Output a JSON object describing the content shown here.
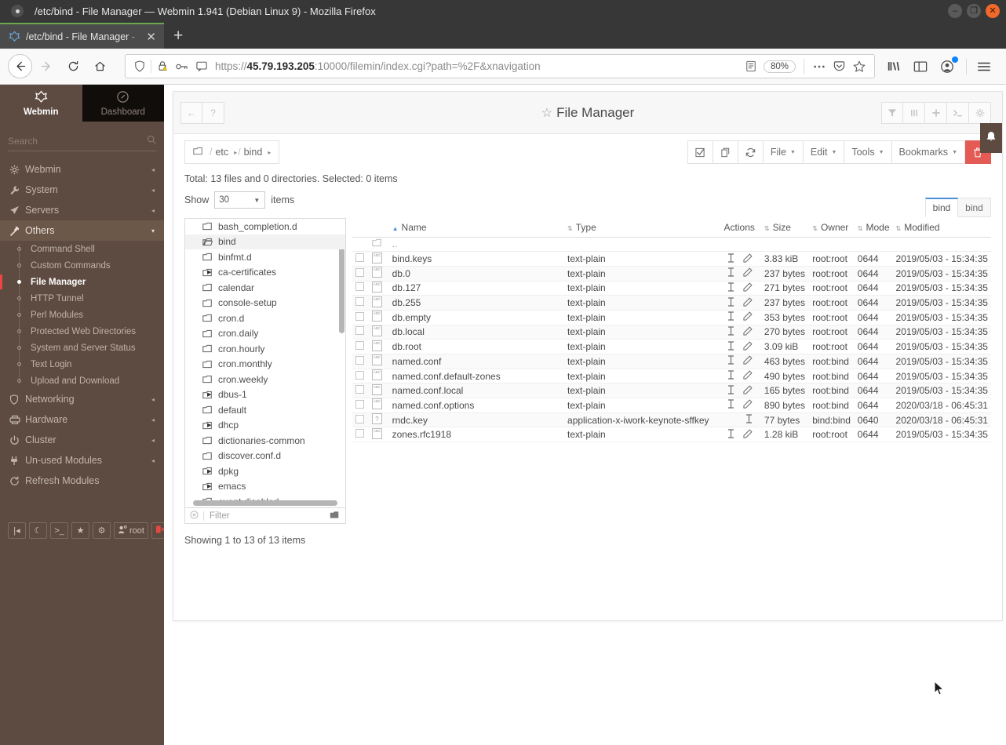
{
  "browser": {
    "window_title": "/etc/bind - File Manager — Webmin 1.941 (Debian Linux 9) - Mozilla Firefox",
    "tab_title": "/etc/bind - File Manager -",
    "tab_close_label": "✕",
    "new_tab_label": "+",
    "minimize_label": "–",
    "maximize_label": "❐",
    "close_label": "✕",
    "url_prefix": "https://",
    "url_host": "45.79.193.205",
    "url_rest": ":10000/filemin/index.cgi?path=%2F&xnavigation",
    "zoom_level": "80%"
  },
  "sidebar": {
    "tabs": [
      {
        "label": "Webmin",
        "icon": "webmin-logo-icon",
        "active": true
      },
      {
        "label": "Dashboard",
        "icon": "gauge-icon",
        "active": false
      }
    ],
    "search_placeholder": "Search",
    "items": [
      {
        "label": "Webmin",
        "icon": "gear-icon",
        "caret": "◂"
      },
      {
        "label": "System",
        "icon": "wrench-icon",
        "caret": "◂"
      },
      {
        "label": "Servers",
        "icon": "paper-plane-icon",
        "caret": "◂"
      },
      {
        "label": "Others",
        "icon": "hammer-icon",
        "caret": "▾",
        "open": true
      }
    ],
    "others_children": [
      {
        "label": "Command Shell"
      },
      {
        "label": "Custom Commands"
      },
      {
        "label": "File Manager",
        "active": true
      },
      {
        "label": "HTTP Tunnel"
      },
      {
        "label": "Perl Modules"
      },
      {
        "label": "Protected Web Directories"
      },
      {
        "label": "System and Server Status"
      },
      {
        "label": "Text Login"
      },
      {
        "label": "Upload and Download"
      }
    ],
    "items_after": [
      {
        "label": "Networking",
        "icon": "shield-icon",
        "caret": "◂"
      },
      {
        "label": "Hardware",
        "icon": "printer-icon",
        "caret": "◂"
      },
      {
        "label": "Cluster",
        "icon": "power-icon",
        "caret": "◂"
      },
      {
        "label": "Un-used Modules",
        "icon": "plug-icon",
        "caret": "◂"
      },
      {
        "label": "Refresh Modules",
        "icon": "refresh-icon",
        "caret": ""
      }
    ],
    "footer_buttons": [
      {
        "name": "collapse-sidebar-button",
        "label": "|◂"
      },
      {
        "name": "night-mode-button",
        "label": "☾"
      },
      {
        "name": "terminal-button",
        "label": ">_"
      },
      {
        "name": "favorites-button",
        "label": "★"
      },
      {
        "name": "theme-settings-button",
        "label": "⚙"
      },
      {
        "name": "user-button",
        "label": "root"
      },
      {
        "name": "logout-button",
        "label": "⇥"
      }
    ]
  },
  "filemanager": {
    "title": "File Manager",
    "star_icon": "☆",
    "header_left_buttons": [
      {
        "name": "back-button",
        "label": "←"
      },
      {
        "name": "help-button",
        "label": "?"
      }
    ],
    "header_right_buttons": [
      {
        "name": "filter-button",
        "label": "⧩"
      },
      {
        "name": "columns-button",
        "label": "|||"
      },
      {
        "name": "add-button",
        "label": "✛"
      },
      {
        "name": "console-button",
        "label": ">_"
      },
      {
        "name": "settings-button",
        "label": "⚙"
      }
    ],
    "notification_icon": "bell-icon",
    "breadcrumb": {
      "root_icon": "folder-icon",
      "segments": [
        "etc",
        "bind"
      ]
    },
    "toolbar": [
      {
        "name": "select-all-button",
        "label": "☑",
        "type": "icon"
      },
      {
        "name": "extract-button",
        "label": "⎋",
        "type": "icon"
      },
      {
        "name": "refresh-button",
        "label": "⟳",
        "type": "icon"
      },
      {
        "name": "file-menu",
        "label": "File",
        "type": "menu"
      },
      {
        "name": "edit-menu",
        "label": "Edit",
        "type": "menu"
      },
      {
        "name": "tools-menu",
        "label": "Tools",
        "type": "menu"
      },
      {
        "name": "bookmarks-menu",
        "label": "Bookmarks",
        "type": "menu"
      },
      {
        "name": "delete-button",
        "label": "🗑",
        "type": "danger"
      }
    ],
    "totals_text": "Total: 13 files and 0 directories. Selected: 0 items",
    "show_label": "Show",
    "show_value": "30",
    "items_label": "items",
    "view_tabs": [
      {
        "label": "bind",
        "active": true
      },
      {
        "label": "bind",
        "active": false
      }
    ],
    "filter_placeholder": "Filter",
    "footer_text": "Showing 1 to 13 of 13 items",
    "tree": [
      {
        "label": "bash_completion.d",
        "expandable": false,
        "selected": false
      },
      {
        "label": "bind",
        "expandable": false,
        "selected": true
      },
      {
        "label": "binfmt.d",
        "expandable": false,
        "selected": false
      },
      {
        "label": "ca-certificates",
        "expandable": true,
        "selected": false
      },
      {
        "label": "calendar",
        "expandable": false,
        "selected": false
      },
      {
        "label": "console-setup",
        "expandable": false,
        "selected": false
      },
      {
        "label": "cron.d",
        "expandable": false,
        "selected": false
      },
      {
        "label": "cron.daily",
        "expandable": false,
        "selected": false
      },
      {
        "label": "cron.hourly",
        "expandable": false,
        "selected": false
      },
      {
        "label": "cron.monthly",
        "expandable": false,
        "selected": false
      },
      {
        "label": "cron.weekly",
        "expandable": false,
        "selected": false
      },
      {
        "label": "dbus-1",
        "expandable": true,
        "selected": false
      },
      {
        "label": "default",
        "expandable": false,
        "selected": false
      },
      {
        "label": "dhcp",
        "expandable": true,
        "selected": false
      },
      {
        "label": "dictionaries-common",
        "expandable": false,
        "selected": false
      },
      {
        "label": "discover.conf.d",
        "expandable": false,
        "selected": false
      },
      {
        "label": "dpkg",
        "expandable": true,
        "selected": false
      },
      {
        "label": "emacs",
        "expandable": true,
        "selected": false
      },
      {
        "label": "event.disabled",
        "expandable": false,
        "selected": false
      }
    ],
    "columns": [
      "Name",
      "Type",
      "Actions",
      "Size",
      "Owner",
      "Mode",
      "Modified"
    ],
    "parent_row_label": "..",
    "rows": [
      {
        "name": "bind.keys",
        "type": "text-plain",
        "size": "3.83 kiB",
        "owner": "root:root",
        "mode": "0644",
        "modified": "2019/05/03 - 15:34:35",
        "icon": "text-file-icon",
        "editable": true
      },
      {
        "name": "db.0",
        "type": "text-plain",
        "size": "237 bytes",
        "owner": "root:root",
        "mode": "0644",
        "modified": "2019/05/03 - 15:34:35",
        "icon": "text-file-icon",
        "editable": true
      },
      {
        "name": "db.127",
        "type": "text-plain",
        "size": "271 bytes",
        "owner": "root:root",
        "mode": "0644",
        "modified": "2019/05/03 - 15:34:35",
        "icon": "text-file-icon",
        "editable": true
      },
      {
        "name": "db.255",
        "type": "text-plain",
        "size": "237 bytes",
        "owner": "root:root",
        "mode": "0644",
        "modified": "2019/05/03 - 15:34:35",
        "icon": "text-file-icon",
        "editable": true
      },
      {
        "name": "db.empty",
        "type": "text-plain",
        "size": "353 bytes",
        "owner": "root:root",
        "mode": "0644",
        "modified": "2019/05/03 - 15:34:35",
        "icon": "text-file-icon",
        "editable": true
      },
      {
        "name": "db.local",
        "type": "text-plain",
        "size": "270 bytes",
        "owner": "root:root",
        "mode": "0644",
        "modified": "2019/05/03 - 15:34:35",
        "icon": "text-file-icon",
        "editable": true
      },
      {
        "name": "db.root",
        "type": "text-plain",
        "size": "3.09 kiB",
        "owner": "root:root",
        "mode": "0644",
        "modified": "2019/05/03 - 15:34:35",
        "icon": "text-file-icon",
        "editable": true
      },
      {
        "name": "named.conf",
        "type": "text-plain",
        "size": "463 bytes",
        "owner": "root:bind",
        "mode": "0644",
        "modified": "2019/05/03 - 15:34:35",
        "icon": "text-file-icon",
        "editable": true
      },
      {
        "name": "named.conf.default-zones",
        "type": "text-plain",
        "size": "490 bytes",
        "owner": "root:bind",
        "mode": "0644",
        "modified": "2019/05/03 - 15:34:35",
        "icon": "text-file-icon",
        "editable": true
      },
      {
        "name": "named.conf.local",
        "type": "text-plain",
        "size": "165 bytes",
        "owner": "root:bind",
        "mode": "0644",
        "modified": "2019/05/03 - 15:34:35",
        "icon": "text-file-icon",
        "editable": true
      },
      {
        "name": "named.conf.options",
        "type": "text-plain",
        "size": "890 bytes",
        "owner": "root:bind",
        "mode": "0644",
        "modified": "2020/03/18 - 06:45:31",
        "icon": "text-file-icon",
        "editable": true
      },
      {
        "name": "rndc.key",
        "type": "application-x-iwork-keynote-sffkey",
        "size": "77 bytes",
        "owner": "bind:bind",
        "mode": "0640",
        "modified": "2020/03/18 - 06:45:31",
        "icon": "unknown-file-icon",
        "editable": false
      },
      {
        "name": "zones.rfc1918",
        "type": "text-plain",
        "size": "1.28 kiB",
        "owner": "root:root",
        "mode": "0644",
        "modified": "2019/05/03 - 15:34:35",
        "icon": "text-file-icon",
        "editable": true
      }
    ]
  },
  "colors": {
    "sidebar_bg": "#5d4b41",
    "accent_red": "#e35b54",
    "tab_accent": "#4a90d9",
    "tab_green": "#6aa84f"
  }
}
